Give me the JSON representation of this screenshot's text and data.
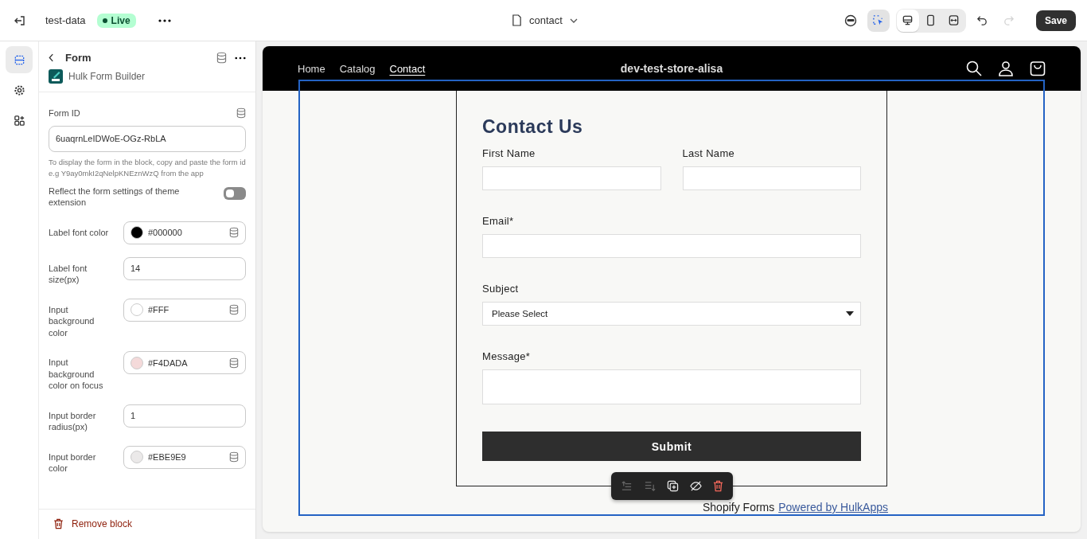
{
  "topbar": {
    "store_name": "test-data",
    "status": {
      "label": "Live",
      "live": true
    },
    "page": "contact",
    "inspector": {
      "selected": true
    },
    "views": [
      {
        "kind": "desktop",
        "selected": true
      },
      {
        "kind": "mobile",
        "selected": false
      },
      {
        "kind": "fullwidth",
        "selected": false
      }
    ],
    "redo": {
      "disabled": true
    },
    "save": "Save"
  },
  "rail": [
    {
      "kind": "sections",
      "selected": true
    },
    {
      "kind": "settings",
      "selected": false
    },
    {
      "kind": "apps",
      "selected": false
    }
  ],
  "panel": {
    "title": "Form",
    "app": "Hulk Form Builder",
    "form_id": {
      "label": "Form ID",
      "value": "6uaqrnLeIDWoE-OGz-RbLA",
      "help": "To display the form in the block, copy and paste the form id e.g Y9ay0mkI2qNelpKNEznWzQ from the app"
    },
    "toggle": {
      "label": "Reflect the form settings of theme extension",
      "on": false
    },
    "settings": [
      {
        "kind": "color",
        "label": "Label font color",
        "value": "#000000",
        "color": "#000000"
      },
      {
        "kind": "text",
        "label": "Label font size(px)",
        "value": "14"
      },
      {
        "kind": "color",
        "label": "Input background color",
        "value": "#FFF",
        "color": "#ffffff"
      },
      {
        "kind": "color",
        "label": "Input background color on focus",
        "value": "#F4DADA",
        "color": "#f4dada"
      },
      {
        "kind": "text",
        "label": "Input border radius(px)",
        "value": "1"
      },
      {
        "kind": "color",
        "label": "Input border color",
        "value": "#EBE9E9",
        "color": "#ebe9e9"
      }
    ],
    "remove": "Remove block"
  },
  "preview": {
    "nav": [
      {
        "label": "Home",
        "selected": false
      },
      {
        "label": "Catalog",
        "selected": false
      },
      {
        "label": "Contact",
        "selected": true
      }
    ],
    "store_title": "dev-test-store-alisa",
    "form": {
      "title": "Contact Us",
      "rows": [
        [
          {
            "kind": "text",
            "label": "First Name"
          },
          {
            "kind": "text",
            "label": "Last Name"
          }
        ],
        [
          {
            "kind": "text",
            "label": "Email*"
          }
        ],
        [
          {
            "kind": "select",
            "label": "Subject",
            "value": "Please Select"
          }
        ],
        [
          {
            "kind": "textarea",
            "label": "Message*"
          }
        ]
      ],
      "submit": "Submit"
    },
    "footer": {
      "text": "Shopify Forms",
      "link": "Powered by HulkApps"
    }
  }
}
